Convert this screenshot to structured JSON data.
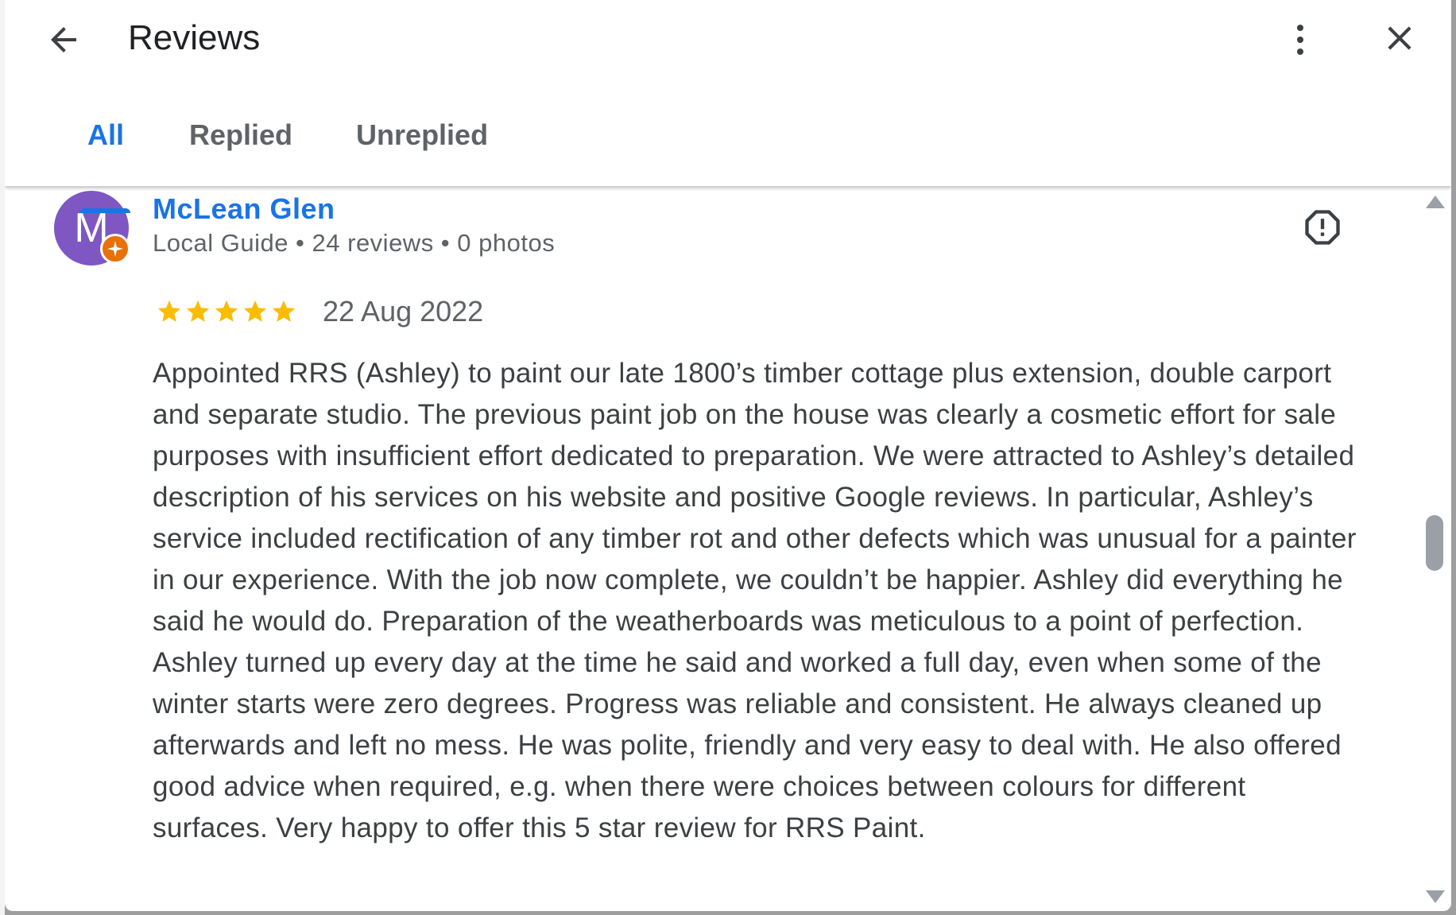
{
  "header": {
    "title": "Reviews",
    "back_icon": "arrow-back-icon",
    "more_icon": "more-vert-icon",
    "close_icon": "close-icon"
  },
  "tabs": [
    {
      "label": "All",
      "active": true
    },
    {
      "label": "Replied",
      "active": false
    },
    {
      "label": "Unreplied",
      "active": false
    }
  ],
  "review": {
    "avatar_letter": "M",
    "avatar_color": "#7e57c2",
    "badge_color": "#e8710a",
    "reviewer_name": "McLean Glen",
    "meta": "Local Guide • 24 reviews • 0 photos",
    "rating": 5,
    "star_color": "#fbbc04",
    "date": "22 Aug 2022",
    "flag_icon": "report-icon",
    "text": "Appointed RRS (Ashley) to paint our late 1800’s timber cottage plus extension, double carport and separate studio. The previous paint job on the house was clearly a cosmetic effort for sale purposes with insufficient effort dedicated to preparation. We were attracted to Ashley’s detailed description of his services on his website and positive Google reviews. In particular, Ashley’s service included rectification of any timber rot and other defects which was unusual for a painter in our experience. With the job now complete, we couldn’t be happier. Ashley did everything he said he would do. Preparation of the weatherboards was meticulous to a point of perfection. Ashley turned up every day at the time he said and worked a full day, even when some of the winter starts were zero degrees. Progress was reliable and consistent. He always cleaned up afterwards and left no mess. He was polite, friendly and very easy to deal with. He also offered good advice when required, e.g. when there were choices between colours for different surfaces. Very happy to offer this 5 star review for RRS Paint."
  },
  "colors": {
    "accent": "#1a73e8",
    "text_primary": "#202124",
    "text_secondary": "#5f6368"
  }
}
